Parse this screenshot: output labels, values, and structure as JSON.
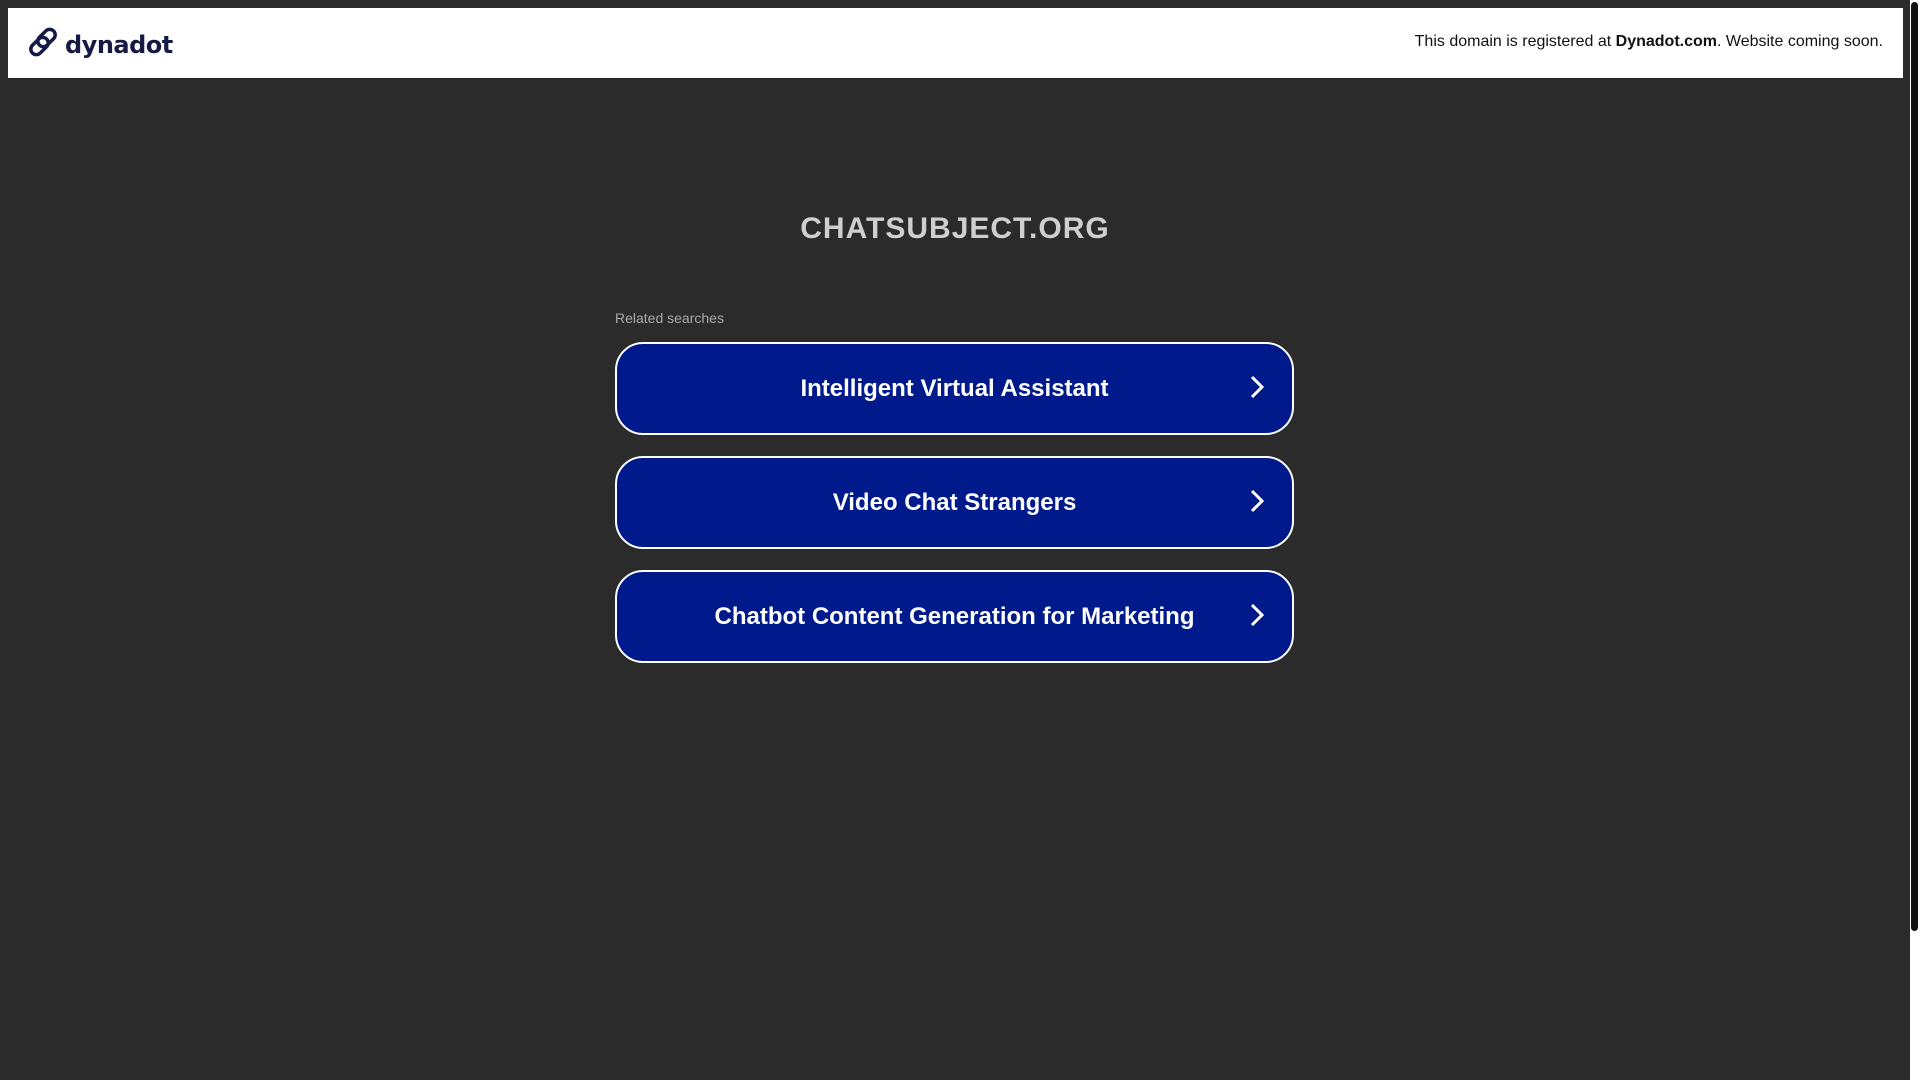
{
  "header": {
    "logo_text": "dynadot",
    "notice_prefix": "This domain is registered at ",
    "notice_brand": "Dynadot.com",
    "notice_suffix": ". Website coming soon."
  },
  "main": {
    "domain_title": "CHATSUBJECT.ORG",
    "related_label": "Related searches",
    "links": [
      {
        "label": "Intelligent Virtual Assistant"
      },
      {
        "label": "Video Chat Strangers"
      },
      {
        "label": "Chatbot Content Generation for Marketing"
      }
    ]
  },
  "colors": {
    "background": "#2b2b2b",
    "button": "#011a8b",
    "logo": "#151a45"
  }
}
